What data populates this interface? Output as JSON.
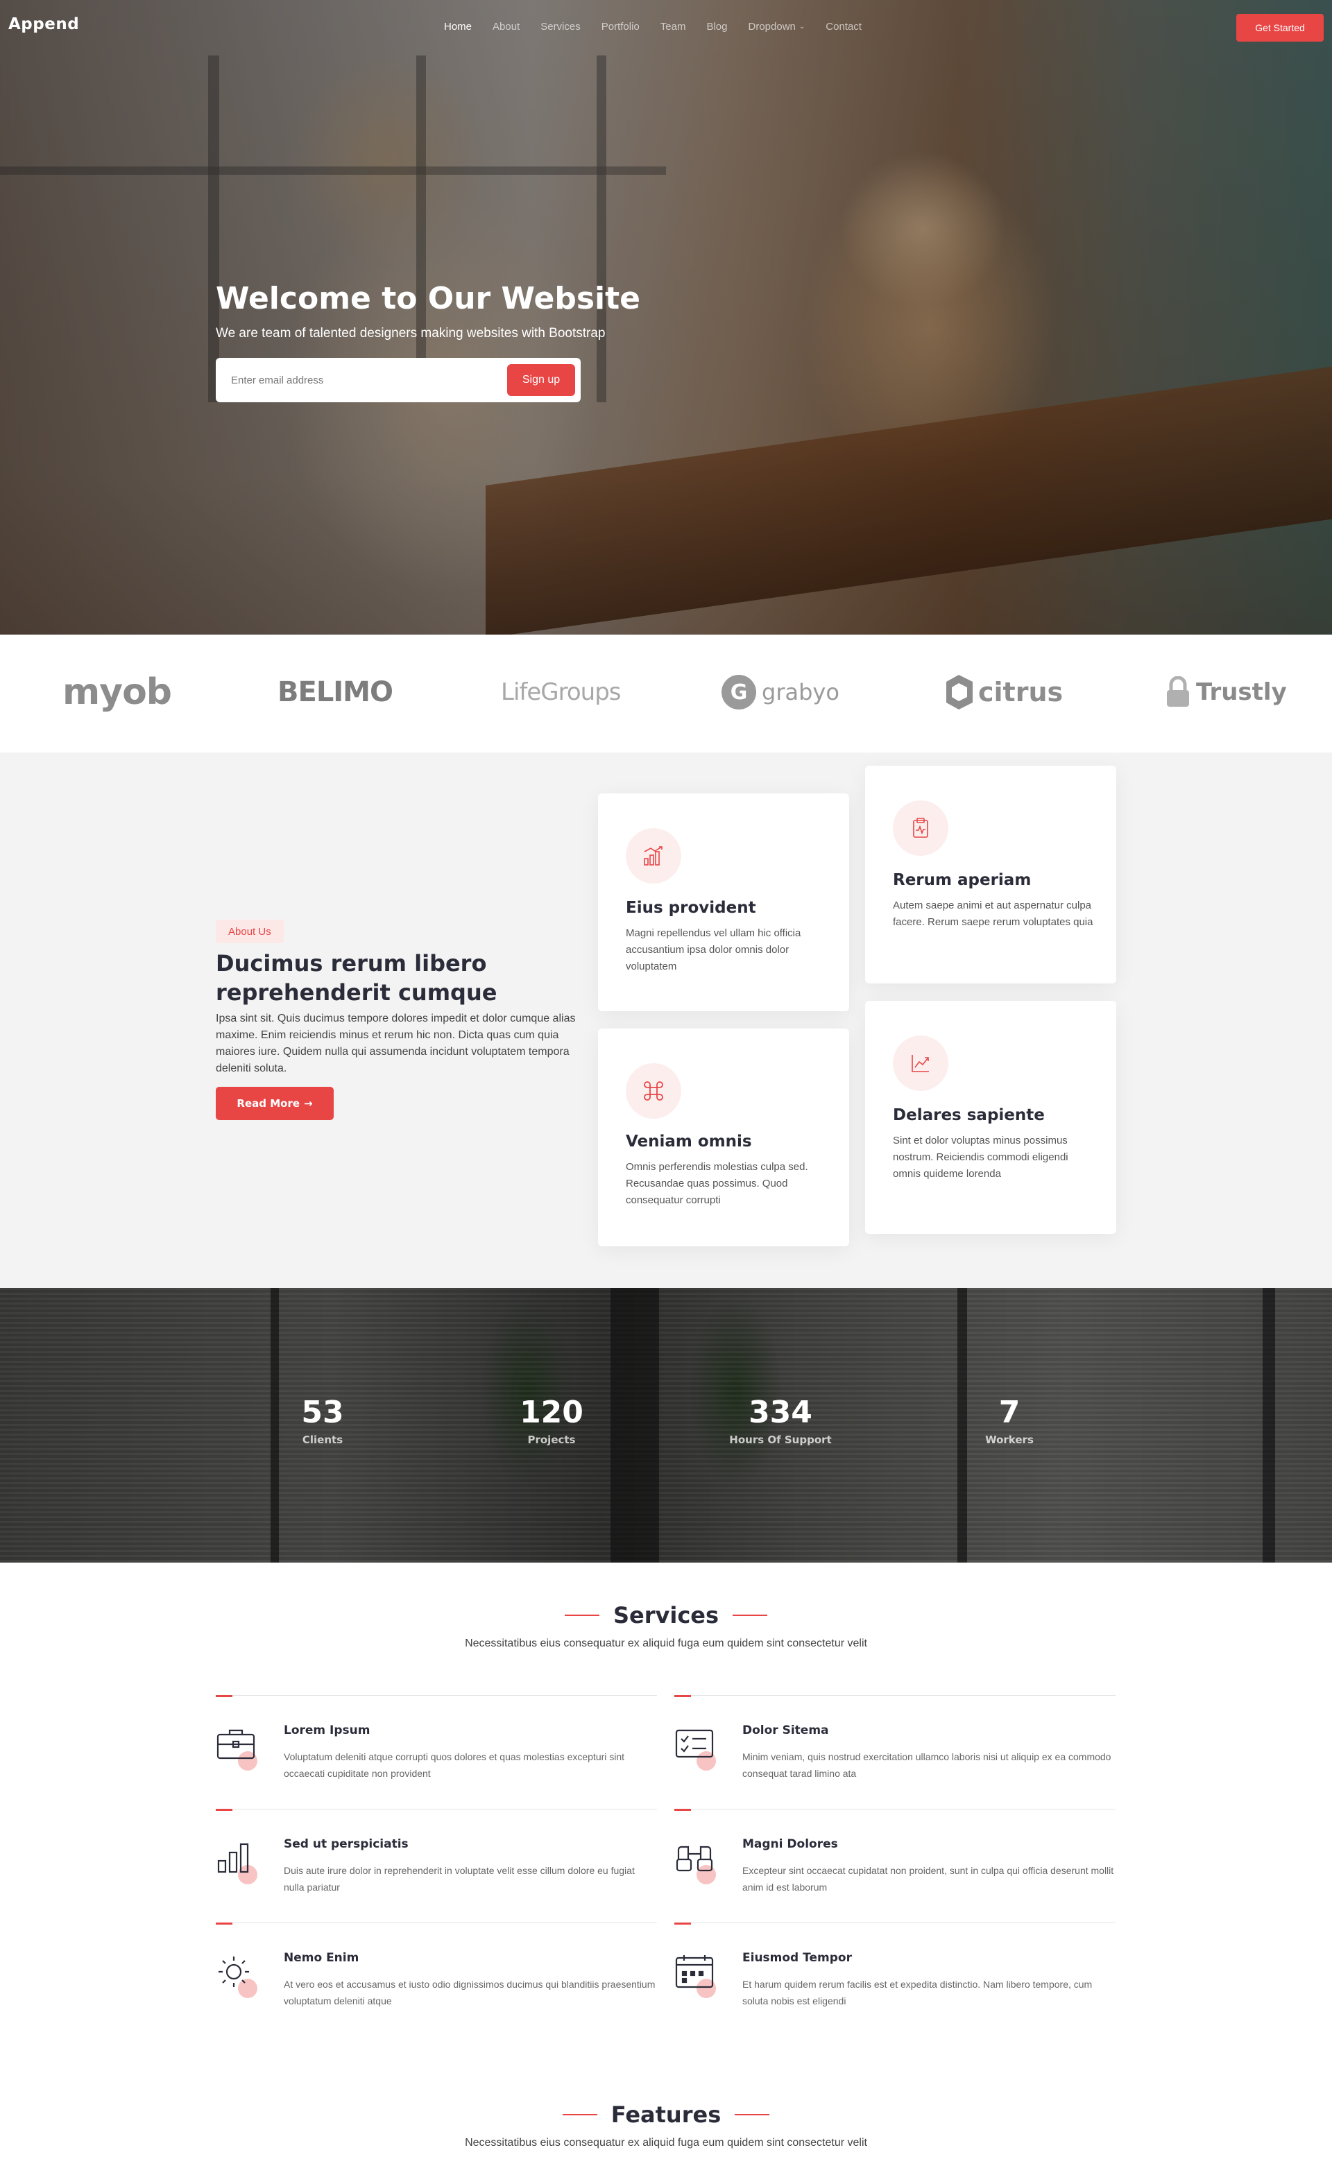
{
  "header": {
    "logo": "Append",
    "nav": [
      {
        "label": "Home",
        "active": true
      },
      {
        "label": "About"
      },
      {
        "label": "Services"
      },
      {
        "label": "Portfolio"
      },
      {
        "label": "Team"
      },
      {
        "label": "Blog"
      },
      {
        "label": "Dropdown",
        "has_chevron": true
      },
      {
        "label": "Contact"
      }
    ],
    "cta": "Get Started"
  },
  "hero": {
    "title": "Welcome to Our Website",
    "subtitle": "We are team of talented designers making websites with Bootstrap",
    "email_placeholder": "Enter email address",
    "signup_label": "Sign up"
  },
  "clients": [
    {
      "name": "myob",
      "icon": "myob-logo"
    },
    {
      "name": "BELIMO",
      "icon": "belimo-logo"
    },
    {
      "name": "LifeGroups",
      "icon": "lifegroups-logo"
    },
    {
      "name": "grabyo",
      "icon": "grabyo-logo"
    },
    {
      "name": "citrus",
      "icon": "citrus-logo"
    },
    {
      "name": "Trustly",
      "icon": "trustly-logo"
    }
  ],
  "about": {
    "badge": "About Us",
    "title": "Ducimus rerum libero reprehenderit cumque",
    "text": "Ipsa sint sit. Quis ducimus tempore dolores impedit et dolor cumque alias maxime. Enim reiciendis minus et rerum hic non. Dicta quas cum quia maiores iure. Quidem nulla qui assumenda incidunt voluptatem tempora deleniti soluta.",
    "button": "Read More",
    "cards": [
      {
        "title": "Eius provident",
        "text": "Magni repellendus vel ullam hic officia accusantium ipsa dolor omnis dolor voluptatem",
        "icon": "bar-chart-icon"
      },
      {
        "title": "Rerum aperiam",
        "text": "Autem saepe animi et aut aspernatur culpa facere. Rerum saepe rerum voluptates quia",
        "icon": "clipboard-pulse-icon"
      },
      {
        "title": "Veniam omnis",
        "text": "Omnis perferendis molestias culpa sed. Recusandae quas possimus. Quod consequatur corrupti",
        "icon": "command-icon"
      },
      {
        "title": "Delares sapiente",
        "text": "Sint et dolor voluptas minus possimus nostrum. Reiciendis commodi eligendi omnis quideme lorenda",
        "icon": "graph-up-icon"
      }
    ]
  },
  "counts": [
    {
      "value": "53",
      "label": "Clients"
    },
    {
      "value": "120",
      "label": "Projects"
    },
    {
      "value": "334",
      "label": "Hours Of Support"
    },
    {
      "value": "7",
      "label": "Workers"
    }
  ],
  "services": {
    "title": "Services",
    "subtitle": "Necessitatibus eius consequatur ex aliquid fuga eum quidem sint consectetur velit",
    "items": [
      {
        "title": "Lorem Ipsum",
        "text": "Voluptatum deleniti atque corrupti quos dolores et quas molestias excepturi sint occaecati cupiditate non provident",
        "icon": "briefcase-icon"
      },
      {
        "title": "Dolor Sitema",
        "text": "Minim veniam, quis nostrud exercitation ullamco laboris nisi ut aliquip ex ea commodo consequat tarad limino ata",
        "icon": "card-checklist-icon"
      },
      {
        "title": "Sed ut perspiciatis",
        "text": "Duis aute irure dolor in reprehenderit in voluptate velit esse cillum dolore eu fugiat nulla pariatur",
        "icon": "bar-chart-icon"
      },
      {
        "title": "Magni Dolores",
        "text": "Excepteur sint occaecat cupidatat non proident, sunt in culpa qui officia deserunt mollit anim id est laborum",
        "icon": "binoculars-icon"
      },
      {
        "title": "Nemo Enim",
        "text": "At vero eos et accusamus et iusto odio dignissimos ducimus qui blanditiis praesentium voluptatum deleniti atque",
        "icon": "brightness-icon"
      },
      {
        "title": "Eiusmod Tempor",
        "text": "Et harum quidem rerum facilis est et expedita distinctio. Nam libero tempore, cum soluta nobis est eligendi",
        "icon": "calendar-icon"
      }
    ]
  },
  "features": {
    "title": "Features",
    "subtitle": "Necessitatibus eius consequatur ex aliquid fuga eum quidem sint consectetur velit"
  },
  "colors": {
    "accent": "#e84545",
    "heading": "#2a2c39",
    "about_bg": "#f3f3f3"
  }
}
